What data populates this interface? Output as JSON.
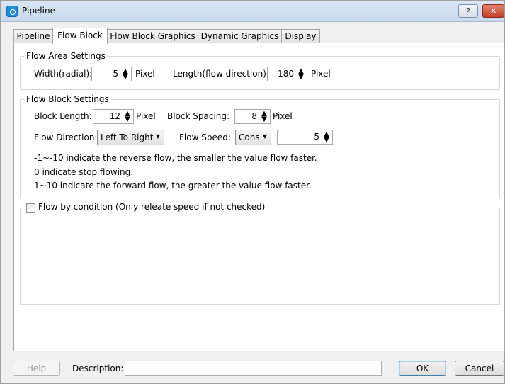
{
  "window": {
    "title": "Pipeline",
    "help_glyph": "?",
    "close_glyph": "✕"
  },
  "tabs": [
    {
      "label": "Pipeline"
    },
    {
      "label": "Flow Block"
    },
    {
      "label": "Flow Block Graphics"
    },
    {
      "label": "Dynamic Graphics"
    },
    {
      "label": "Display"
    }
  ],
  "active_tab": "Flow Block",
  "flow_area": {
    "legend": "Flow Area Settings",
    "width_label": "Width(radial):",
    "width_value": "5",
    "width_unit": "Pixel",
    "length_label": "Length(flow direction):",
    "length_value": "180",
    "length_unit": "Pixel"
  },
  "flow_block": {
    "legend": "Flow Block Settings",
    "block_length_label": "Block Length:",
    "block_length_value": "12",
    "block_length_unit": "Pixel",
    "block_spacing_label": "Block Spacing:",
    "block_spacing_value": "8",
    "block_spacing_unit": "Pixel",
    "direction_label": "Flow Direction:",
    "direction_value": "Left To Right",
    "speed_label": "Flow Speed:",
    "speed_mode_value": "Cons",
    "speed_value": "5",
    "note_1": "-1~-10 indicate the reverse flow, the smaller the value flow faster.",
    "note_2": "0 indicate stop flowing.",
    "note_3": "1~10  indicate the forward flow, the greater the value flow faster."
  },
  "condition": {
    "checked": false,
    "label": "Flow by condition (Only releate speed if not checked)"
  },
  "footer": {
    "help_label": "Help",
    "description_label": "Description:",
    "description_value": "",
    "ok_label": "OK",
    "cancel_label": "Cancel"
  }
}
